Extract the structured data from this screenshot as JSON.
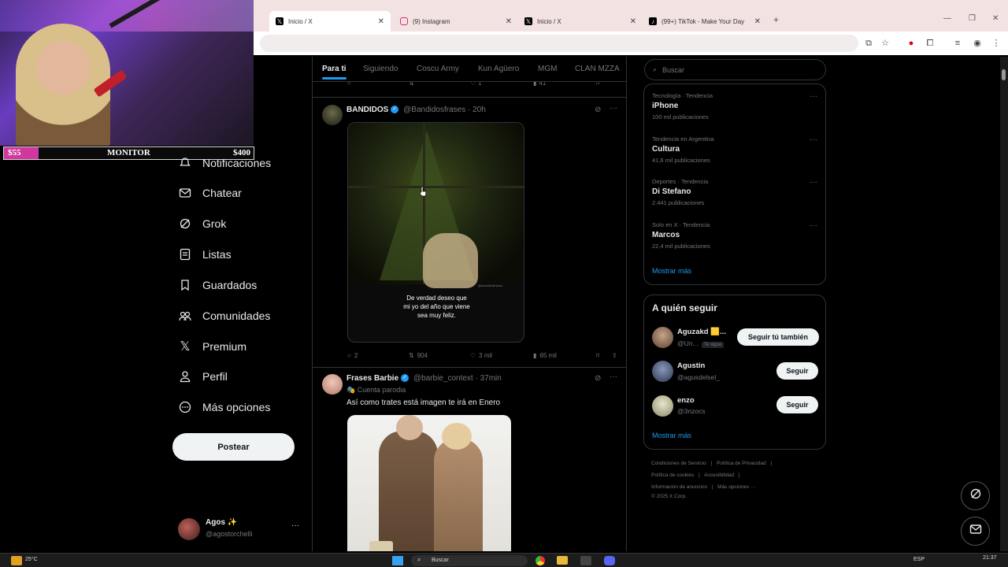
{
  "browser": {
    "tabs": [
      {
        "title": "Inicio / X",
        "icon": "x-logo-icon",
        "active": true
      },
      {
        "title": "(9) Instagram",
        "icon": "instagram-icon",
        "active": false
      },
      {
        "title": "Inicio / X",
        "icon": "x-logo-icon",
        "active": false
      },
      {
        "title": "(99+) TikTok - Make Your Day",
        "icon": "tiktok-icon",
        "active": false
      }
    ],
    "new_tab": "+"
  },
  "stream_overlay": {
    "left_amount": "$55",
    "label": "MONITOR",
    "right_amount": "$400",
    "progress": 0.1375,
    "progress_color": "#d0379f"
  },
  "nav": {
    "items": [
      {
        "label": "Notificaciones",
        "icon": "bell-icon"
      },
      {
        "label": "Chatear",
        "icon": "envelope-icon"
      },
      {
        "label": "Grok",
        "icon": "grok-icon"
      },
      {
        "label": "Listas",
        "icon": "list-icon"
      },
      {
        "label": "Guardados",
        "icon": "bookmark-icon"
      },
      {
        "label": "Comunidades",
        "icon": "communities-icon"
      },
      {
        "label": "Premium",
        "icon": "x-logo-icon"
      },
      {
        "label": "Perfil",
        "icon": "person-icon"
      },
      {
        "label": "Más opciones",
        "icon": "more-circle-icon"
      }
    ],
    "post_button": "Postear",
    "user": {
      "name": "Agos ✨",
      "handle": "@agostorchelli",
      "more": "···"
    }
  },
  "feed": {
    "tabs": [
      "Para ti",
      "Siguiendo",
      "Coscu Army",
      "Kun Agüero",
      "MGM",
      "CLAN MZZA"
    ],
    "prev_tweet_actions": {
      "likes": "1",
      "views": "41"
    },
    "tweets": [
      {
        "name": "BANDIDOS",
        "handle": "@Bandidosfrases",
        "time": "· 20h",
        "image_caption": "De verdad deseo que\nmi yo del año que viene\nsea muy feliz.",
        "watermark": "@bandidosfrases",
        "replies": "2",
        "reposts": "904",
        "likes": "3 mil",
        "views": "65 mil"
      },
      {
        "name": "Frases Barbie",
        "handle": "@barbie_context",
        "time": "· 37min",
        "subtitle": "Cuenta parodia",
        "text": "Así como trates está imagen te irá en Enero"
      }
    ]
  },
  "search": {
    "placeholder": "Buscar"
  },
  "trends": {
    "items": [
      {
        "category": "Tecnología · Tendencia",
        "name": "iPhone",
        "count": "100 mil publicaciones"
      },
      {
        "category": "Tendencia en Argentina",
        "name": "Cultura",
        "count": "41,6 mil publicaciones"
      },
      {
        "category": "Deportes · Tendencia",
        "name": "Di Stefano",
        "count": "2.441 publicaciones"
      },
      {
        "category": "Solo en X · Tendencia",
        "name": "Marcos",
        "count": "22,4 mil publicaciones"
      }
    ],
    "show_more": "Mostrar más"
  },
  "who_to_follow": {
    "title": "A quién seguir",
    "users": [
      {
        "name": "Aguzakd 🟨...",
        "handle": "@Un...",
        "badge": "Te sigue",
        "button": "Seguir tú también"
      },
      {
        "name": "Agustin",
        "handle": "@agusdelsel_",
        "button": "Seguir"
      },
      {
        "name": "enzo",
        "handle": "@3nzocs",
        "button": "Seguir"
      }
    ],
    "show_more": "Mostrar más"
  },
  "footer": {
    "links": [
      "Condiciones de Servicio",
      "Política de Privacidad",
      "Política de cookies",
      "Accesibilidad",
      "Información de anuncios",
      "Más opciones ···"
    ],
    "copyright": "© 2025 X Corp."
  },
  "taskbar": {
    "weather": "25°C",
    "search": "Buscar",
    "lang": "ESP",
    "time": "21:37"
  },
  "colors": {
    "accent": "#1d9bf0",
    "bg": "#000000",
    "text": "#e7e9ea",
    "muted": "#71767b"
  }
}
